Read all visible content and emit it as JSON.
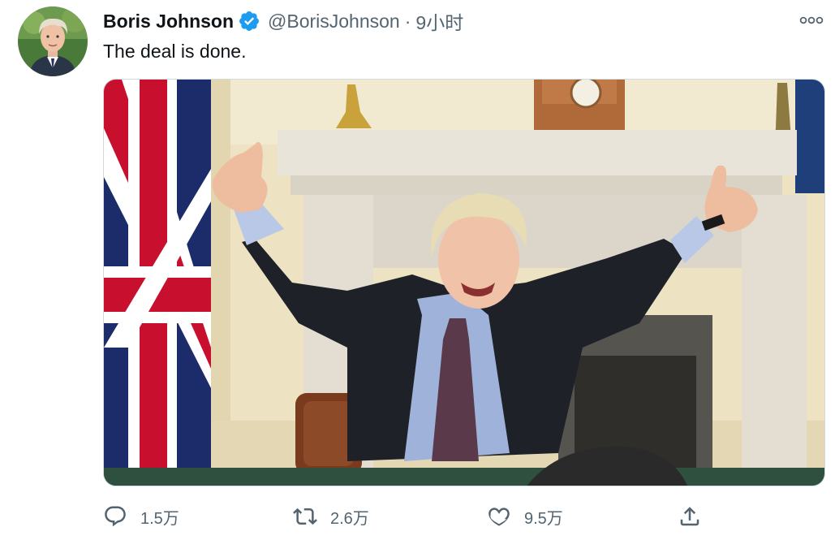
{
  "author": {
    "display_name": "Boris Johnson",
    "handle": "@BorisJohnson",
    "separator": "·",
    "time": "9小时",
    "verified": true,
    "avatar_icon": "avatar"
  },
  "tweet": {
    "text": "The deal is done."
  },
  "actions": {
    "reply": {
      "icon": "reply-icon",
      "count": "1.5万"
    },
    "retweet": {
      "icon": "retweet-icon",
      "count": "2.6万"
    },
    "like": {
      "icon": "heart-icon",
      "count": "9.5万"
    },
    "share": {
      "icon": "share-icon"
    }
  },
  "colors": {
    "text_primary": "#0f1419",
    "text_secondary": "#536471",
    "verified_blue": "#1d9bf0"
  }
}
